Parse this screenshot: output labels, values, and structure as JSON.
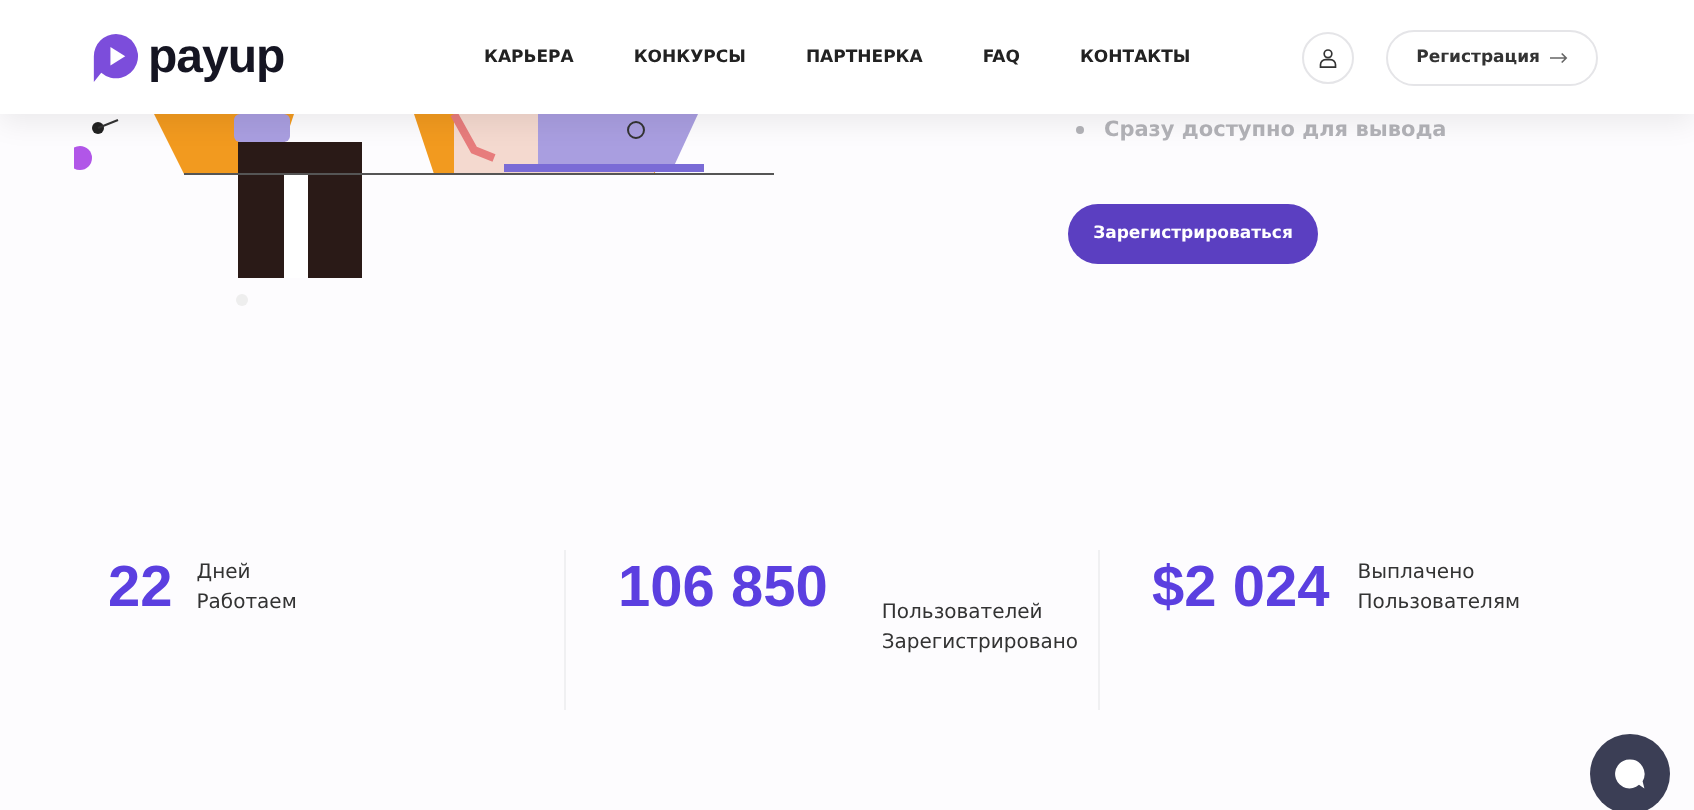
{
  "header": {
    "logo": "payup",
    "nav": [
      {
        "label": "КАРЬЕРА"
      },
      {
        "label": "КОНКУРСЫ"
      },
      {
        "label": "ПАРТНЕРКА"
      },
      {
        "label": "FAQ"
      },
      {
        "label": "КОНТАКТЫ"
      }
    ],
    "register_button": "Регистрация"
  },
  "hero": {
    "bullets": [
      "Сразу доступно для вывода"
    ],
    "cta": "Зарегистрироваться"
  },
  "stats": [
    {
      "value": "22",
      "label_1": "Дней",
      "label_2": "Работаем"
    },
    {
      "value": "106 850",
      "label_1": "Пользователей",
      "label_2": "Зарегистрировано"
    },
    {
      "value": "$2 024",
      "label_1": "Выплачено",
      "label_2": "Пользователям"
    }
  ]
}
